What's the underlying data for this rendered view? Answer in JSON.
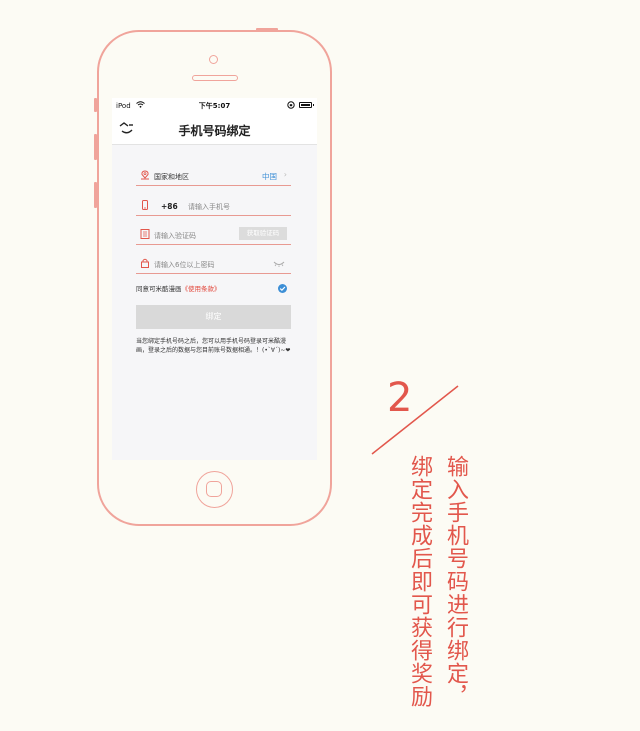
{
  "status_bar": {
    "carrier": "iPod",
    "time": "下午5:07"
  },
  "nav": {
    "title": "手机号码绑定"
  },
  "form": {
    "region_label": "国家和地区",
    "region_value": "中国",
    "phone_prefix": "+86",
    "phone_placeholder": "请输入手机号",
    "code_placeholder": "请输入验证码",
    "get_code_button": "获取验证码",
    "password_placeholder": "请输入6位以上密码",
    "agree_text": "同意可米酷漫画",
    "terms_link": "《使用条款》",
    "bind_button": "绑定",
    "notice": "当您绑定手机号码之后，您可以用手机号码登录可米酷漫画，登录之后的数据与您目前账号数据相通。！(•`∀´)~❤"
  },
  "annotation": {
    "step_number": "2",
    "line1": "输入手机号码进行绑定，",
    "line2": "绑定完成后即可获得奖励"
  },
  "colors": {
    "accent": "#e2574c",
    "phone_outline": "#f0a49b",
    "link_blue": "#3d8fd6",
    "background": "#fcfbf4"
  }
}
